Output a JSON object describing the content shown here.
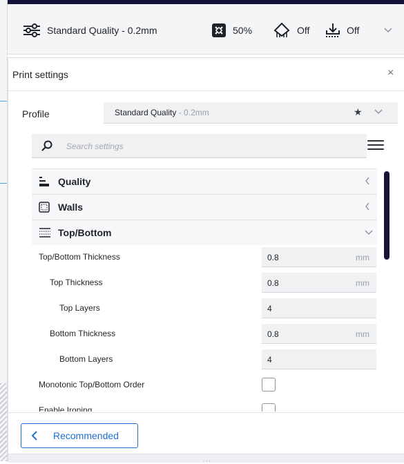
{
  "header": {
    "profile_label": "Standard Quality - 0.2mm",
    "infill_value": "50%",
    "support_value": "Off",
    "adhesion_value": "Off"
  },
  "panel": {
    "title": "Print settings",
    "close_glyph": "×"
  },
  "profile": {
    "label": "Profile",
    "name": "Standard Quality",
    "name_suffix": " - 0.2mm"
  },
  "search": {
    "placeholder": "Search settings"
  },
  "categories": [
    {
      "label": "Quality",
      "icon": "quality-icon",
      "state": "collapsed"
    },
    {
      "label": "Walls",
      "icon": "walls-icon",
      "state": "collapsed"
    },
    {
      "label": "Top/Bottom",
      "icon": "top-bottom-icon",
      "state": "expanded"
    }
  ],
  "settings": [
    {
      "label": "Top/Bottom Thickness",
      "value": "0.8",
      "unit": "mm"
    },
    {
      "label": "Top Thickness",
      "value": "0.8",
      "unit": "mm"
    },
    {
      "label": "Top Layers",
      "value": "4",
      "unit": ""
    },
    {
      "label": "Bottom Thickness",
      "value": "0.8",
      "unit": "mm"
    },
    {
      "label": "Bottom Layers",
      "value": "4",
      "unit": ""
    },
    {
      "label": "Monotonic Top/Bottom Order",
      "checked": false
    },
    {
      "label": "Enable Ironing",
      "checked": false
    }
  ],
  "footer": {
    "recommended_label": "Recommended",
    "grip": "···"
  },
  "colors": {
    "accent": "#1f6fd1",
    "top_bar": "#14143a",
    "scrollbar": "#14143a"
  }
}
